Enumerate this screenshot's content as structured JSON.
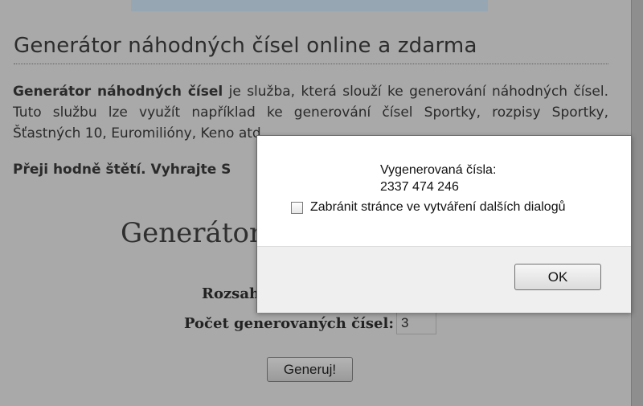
{
  "page": {
    "title": "Generátor náhodných čísel online a zdarma",
    "intro_bold": "Generátor náhodných čísel",
    "intro_rest": " je služba, která slouží ke generování náhodných čísel. Tuto službu lze využít například ke generování čísel Sportky, rozpisy Sportky, Šťastných 10, Euromilióny, Keno atd.",
    "wish": "Přeji hodně štětí. Vyhrajte S",
    "generator_heading": "Generátor",
    "range_label": "Rozsah",
    "count_label": "Počet generovaných čísel:",
    "count_value": "3",
    "generate_button": "Generuj!"
  },
  "dialog": {
    "message_line1": "Vygenerovaná čísla:",
    "message_line2": "2337 474 246",
    "checkbox_label": "Zabránit stránce ve vytváření dalších dialogů",
    "checkbox_checked": false,
    "ok_button": "OK"
  },
  "colors": {
    "overlay": "#a9a9a9",
    "dialog_bg": "#ffffff",
    "dialog_footer": "#efefef"
  }
}
